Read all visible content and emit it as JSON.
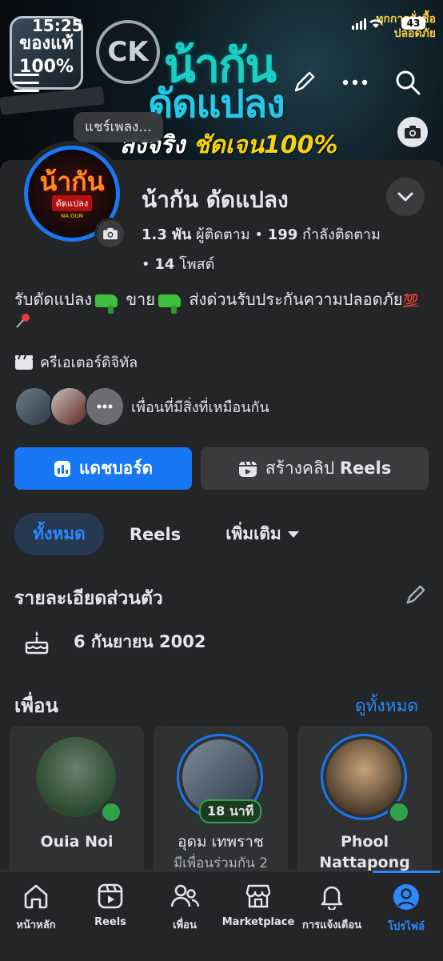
{
  "status_bar": {
    "time": "15:25",
    "battery": "43"
  },
  "cover": {
    "badge_left": "ของแท้ 100%",
    "logo": "CK",
    "title_line1": "น้ากัน",
    "title_line2": "ดัดแปลง",
    "banner_text": "ส่งจริง ",
    "banner_highlight": "ชัดเจน100%",
    "tag": "ทุกการสั่งซื้อ ปลอดภัย"
  },
  "tooltip": "แชร์เพลง...",
  "avatar": {
    "line1": "น้ากัน",
    "line2": "ดัดแปลง",
    "line3": "NA GUN"
  },
  "profile": {
    "name": "น้ากัน ดัดแปลง",
    "followers_count": "1.3 พัน",
    "followers_label": " ผู้ติดตาม • ",
    "following_count": "199",
    "following_label": " กำลังติดตาม",
    "posts_prefix": "• ",
    "posts_count": "14",
    "posts_label": " โพสต์",
    "bio_part1": "รับดัดแปลง",
    "bio_part2": " ขาย",
    "bio_part3": " ส่งด่วนรับประกันความปลอดภัย",
    "bio_emoji_100": "💯",
    "category": "ครีเอเตอร์ดิจิทัล",
    "mutual_label": "เพื่อนที่มีสิ่งที่เหมือนกัน"
  },
  "buttons": {
    "dashboard": "แดชบอร์ด",
    "create_reel_prefix": "สร้างคลิป ",
    "create_reel_bold": "Reels"
  },
  "tabs": {
    "all": "ทั้งหมด",
    "reels": "Reels",
    "more": "เพิ่มเติม"
  },
  "details": {
    "title": "รายละเอียดส่วนตัว",
    "birthday": "6 กันยายน  2002"
  },
  "friends": {
    "title": "เพื่อน",
    "see_all": "ดูทั้งหมด",
    "cards": [
      {
        "name": "Ouia Noi",
        "sub": ""
      },
      {
        "name": "อุดม เทพราช",
        "sub": "มีเพื่อนร่วมกัน 2",
        "time_badge": "18 นาที"
      },
      {
        "name": "Phool Nattapong",
        "sub": ""
      }
    ]
  },
  "bottom_nav": [
    {
      "label": "หน้าหลัก",
      "icon": "home-icon"
    },
    {
      "label": "Reels",
      "icon": "reels-icon"
    },
    {
      "label": "เพื่อน",
      "icon": "friends-icon"
    },
    {
      "label": "Marketplace",
      "icon": "marketplace-icon"
    },
    {
      "label": "การแจ้งเตือน",
      "icon": "bell-icon"
    },
    {
      "label": "โปรไฟล์",
      "icon": "profile-icon"
    }
  ],
  "colors": {
    "accent": "#1877f2",
    "link": "#2d88ff",
    "background": "#242526",
    "online": "#31a24c"
  }
}
